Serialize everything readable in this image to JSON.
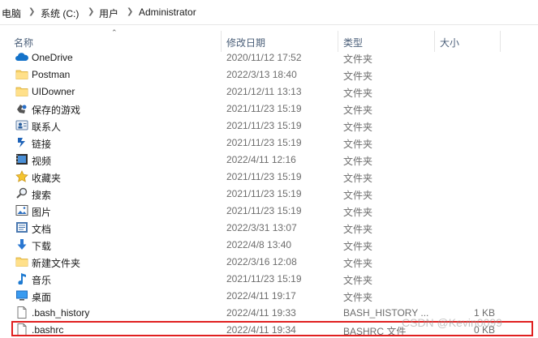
{
  "breadcrumb": {
    "items": [
      "电脑",
      "系统 (C:)",
      "用户",
      "Administrator"
    ]
  },
  "columns": {
    "name": "名称",
    "date": "修改日期",
    "type": "类型",
    "size": "大小"
  },
  "files": [
    {
      "name": "OneDrive",
      "date": "2020/11/12 17:52",
      "type": "文件夹",
      "size": "",
      "icon": "onedrive-icon"
    },
    {
      "name": "Postman",
      "date": "2022/3/13 18:40",
      "type": "文件夹",
      "size": "",
      "icon": "folder-icon"
    },
    {
      "name": "UIDowner",
      "date": "2021/12/11 13:13",
      "type": "文件夹",
      "size": "",
      "icon": "folder-icon"
    },
    {
      "name": "保存的游戏",
      "date": "2021/11/23 15:19",
      "type": "文件夹",
      "size": "",
      "icon": "saved-games-icon"
    },
    {
      "name": "联系人",
      "date": "2021/11/23 15:19",
      "type": "文件夹",
      "size": "",
      "icon": "contacts-icon"
    },
    {
      "name": "链接",
      "date": "2021/11/23 15:19",
      "type": "文件夹",
      "size": "",
      "icon": "links-icon"
    },
    {
      "name": "视频",
      "date": "2022/4/11 12:16",
      "type": "文件夹",
      "size": "",
      "icon": "videos-icon"
    },
    {
      "name": "收藏夹",
      "date": "2021/11/23 15:19",
      "type": "文件夹",
      "size": "",
      "icon": "favorites-icon"
    },
    {
      "name": "搜索",
      "date": "2021/11/23 15:19",
      "type": "文件夹",
      "size": "",
      "icon": "searches-icon"
    },
    {
      "name": "图片",
      "date": "2021/11/23 15:19",
      "type": "文件夹",
      "size": "",
      "icon": "pictures-icon"
    },
    {
      "name": "文档",
      "date": "2022/3/31 13:07",
      "type": "文件夹",
      "size": "",
      "icon": "documents-icon"
    },
    {
      "name": "下载",
      "date": "2022/4/8 13:40",
      "type": "文件夹",
      "size": "",
      "icon": "downloads-icon"
    },
    {
      "name": "新建文件夹",
      "date": "2022/3/16 12:08",
      "type": "文件夹",
      "size": "",
      "icon": "folder-icon"
    },
    {
      "name": "音乐",
      "date": "2021/11/23 15:19",
      "type": "文件夹",
      "size": "",
      "icon": "music-icon"
    },
    {
      "name": "桌面",
      "date": "2022/4/11 19:17",
      "type": "文件夹",
      "size": "",
      "icon": "desktop-icon"
    },
    {
      "name": ".bash_history",
      "date": "2022/4/11 19:33",
      "type": "BASH_HISTORY ...",
      "size": "1 KB",
      "icon": "file-icon"
    },
    {
      "name": ".bashrc",
      "date": "2022/4/11 19:34",
      "type": "BASHRC 文件",
      "size": "0 KB",
      "icon": "file-icon"
    }
  ],
  "watermark": "CSDN @Kevin0099",
  "colors": {
    "highlight": "#e02020",
    "folder": "#f7d36b",
    "header_text": "#4c607a"
  }
}
